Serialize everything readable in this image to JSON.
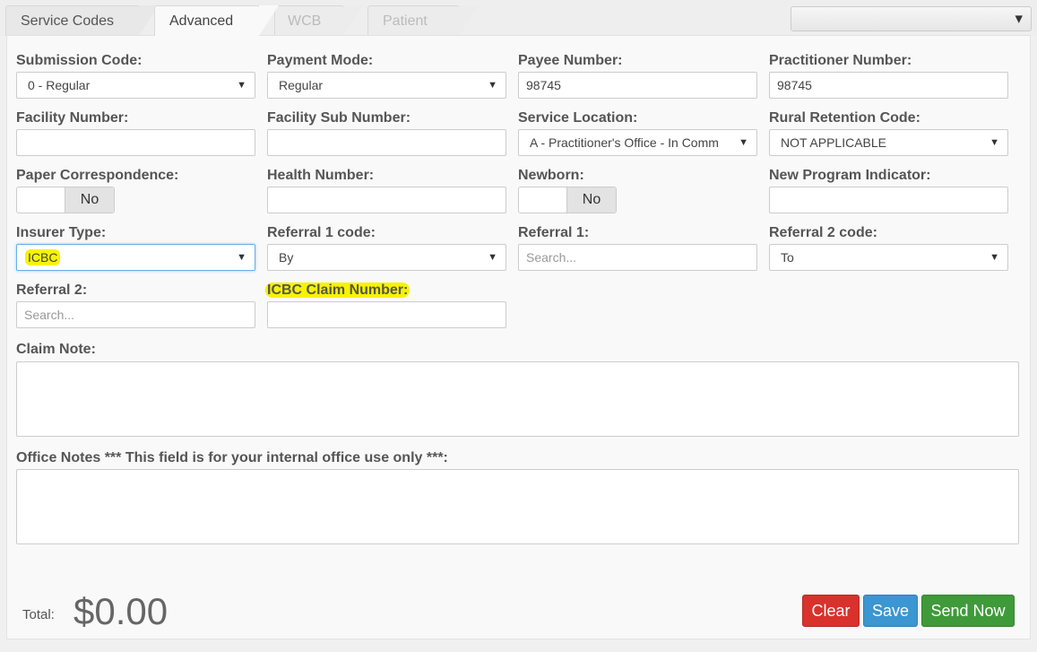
{
  "tabs": [
    {
      "label": "Service Codes",
      "state": "normal"
    },
    {
      "label": "Advanced",
      "state": "active"
    },
    {
      "label": "WCB",
      "state": "disabled"
    },
    {
      "label": "Patient",
      "state": "disabled"
    }
  ],
  "top_select": {
    "value": ""
  },
  "fields": {
    "submission_code": {
      "label": "Submission Code:",
      "value": "0 - Regular"
    },
    "payment_mode": {
      "label": "Payment Mode:",
      "value": "Regular"
    },
    "payee_number": {
      "label": "Payee Number:",
      "value": "98745"
    },
    "practitioner_number": {
      "label": "Practitioner Number:",
      "value": "98745"
    },
    "facility_number": {
      "label": "Facility Number:",
      "value": ""
    },
    "facility_sub_number": {
      "label": "Facility Sub Number:",
      "value": ""
    },
    "service_location": {
      "label": "Service Location:",
      "value": "A - Practitioner's Office - In Comm"
    },
    "rural_retention_code": {
      "label": "Rural Retention Code:",
      "value": "NOT APPLICABLE"
    },
    "paper_correspondence": {
      "label": "Paper Correspondence:",
      "value": "No"
    },
    "health_number": {
      "label": "Health Number:",
      "value": ""
    },
    "newborn": {
      "label": "Newborn:",
      "value": "No"
    },
    "new_program_indicator": {
      "label": "New Program Indicator:",
      "value": ""
    },
    "insurer_type": {
      "label": "Insurer Type:",
      "value": "ICBC"
    },
    "referral_1_code": {
      "label": "Referral 1 code:",
      "value": "By"
    },
    "referral_1": {
      "label": "Referral 1:",
      "placeholder": "Search..."
    },
    "referral_2_code": {
      "label": "Referral 2 code:",
      "value": "To"
    },
    "referral_2": {
      "label": "Referral 2:",
      "placeholder": "Search..."
    },
    "icbc_claim_number": {
      "label": "ICBC Claim Number:",
      "value": ""
    },
    "claim_note": {
      "label": "Claim Note:",
      "value": ""
    },
    "office_notes": {
      "label": "Office Notes *** This field is for your internal office use only ***:",
      "value": ""
    }
  },
  "footer": {
    "total_label": "Total:",
    "total_value": "$0.00",
    "clear_label": "Clear",
    "save_label": "Save",
    "send_label": "Send Now"
  },
  "colors": {
    "highlight": "#f7f300",
    "clear": "#d9312c",
    "save": "#3b96d1",
    "send": "#3f9a3a"
  }
}
